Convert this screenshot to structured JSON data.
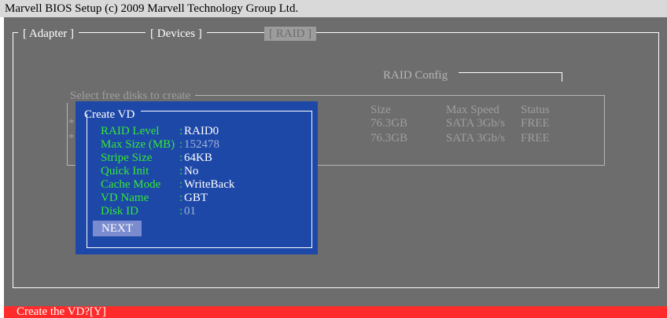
{
  "window": {
    "title": "Marvell BIOS Setup (c) 2009 Marvell Technology Group Ltd."
  },
  "tabs": [
    {
      "label": "[ Adapter ]",
      "active": false
    },
    {
      "label": "[ Devices ]",
      "active": false
    },
    {
      "label": "[   RAID   ]",
      "active": true
    }
  ],
  "raid_config": {
    "label": "RAID Config"
  },
  "disk_select": {
    "label": "Select free disks to create",
    "headers": {
      "size": "Size",
      "max_speed": "Max Speed",
      "status": "Status"
    },
    "rows": [
      {
        "marker": "*",
        "size": "76.3GB",
        "max_speed": "SATA 3Gb/s",
        "status": "FREE"
      },
      {
        "marker": "*",
        "size": "76.3GB",
        "max_speed": "SATA 3Gb/s",
        "status": "FREE"
      }
    ]
  },
  "dialog": {
    "title": "Create VD",
    "fields": [
      {
        "label": "RAID Level",
        "sep": ":",
        "value": "RAID0"
      },
      {
        "label": "Max Size (MB)",
        "sep": ":",
        "value": "152478"
      },
      {
        "label": "Stripe Size",
        "sep": ":",
        "value": "64KB"
      },
      {
        "label": "Quick Init",
        "sep": ":",
        "value": "No"
      },
      {
        "label": "Cache Mode",
        "sep": ":",
        "value": "WriteBack"
      },
      {
        "label": "VD Name",
        "sep": ":",
        "value": "GBT"
      },
      {
        "label": "Disk ID",
        "sep": ":",
        "value": "01"
      }
    ],
    "next_label": "NEXT"
  },
  "status_bar": {
    "text": "Create the VD?[Y]"
  },
  "colors": {
    "background": "#6d6d6d",
    "dialog_bg": "#1e48a8",
    "field_label": "#33e833",
    "status_bar": "#ff2b2b",
    "next_button": "#7b8bd0"
  }
}
